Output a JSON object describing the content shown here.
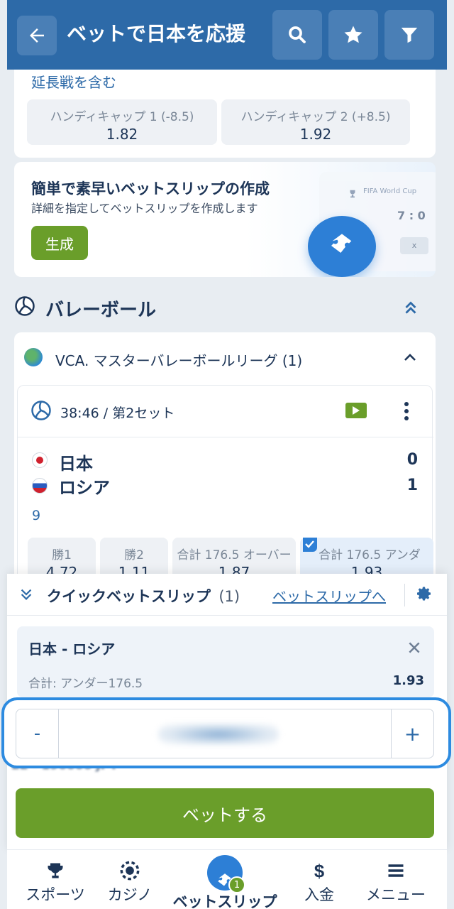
{
  "header": {
    "title": "ベットで日本を応援"
  },
  "top_market": {
    "title": "延長戦を含む",
    "odds": [
      {
        "label": "ハンディキャップ 1 (-8.5)",
        "value": "1.82"
      },
      {
        "label": "ハンディキャップ 2 (+8.5)",
        "value": "1.92"
      }
    ]
  },
  "promo": {
    "title": "簡単で素早いベットスリップの作成",
    "subtitle": "詳細を指定してベットスリップを作成します",
    "button": "生成",
    "art_text": "FIFA World Cup",
    "art_score": "7 : 0",
    "art_x": "x"
  },
  "section": {
    "title": "バレーボール"
  },
  "league": {
    "name": "VCA. マスターバレーボールリーグ (1)"
  },
  "match": {
    "time": "38:46 / 第2セット",
    "team1": "日本",
    "score1": "0",
    "team2": "ロシア",
    "score2": "1",
    "extra": "9",
    "odds": [
      {
        "label": "勝1",
        "value": "4.72"
      },
      {
        "label": "勝2",
        "value": "1.11"
      },
      {
        "label": "合計 176.5 オーバー",
        "value": "1.87"
      },
      {
        "label": "合計 176.5 アンダ",
        "value": "1.93"
      }
    ]
  },
  "quick_slip": {
    "title": "クイックベットスリップ",
    "count": "(1)",
    "link": "ベットスリップへ",
    "bet_match": "日本 - ロシア",
    "bet_market": "合計: アンダー176.5",
    "bet_odds": "1.93",
    "minus": "-",
    "plus": "+",
    "limits": "22 - 196000 JPY",
    "submit": "ベットする"
  },
  "tabs": [
    {
      "label": "スポーツ"
    },
    {
      "label": "カジノ"
    },
    {
      "label": "ベットスリップ",
      "badge": "1"
    },
    {
      "label": "入金"
    },
    {
      "label": "メニュー"
    }
  ],
  "colors": {
    "header": "#2d6aa8",
    "green": "#6a9e2a",
    "accent": "#2d7fd6"
  }
}
